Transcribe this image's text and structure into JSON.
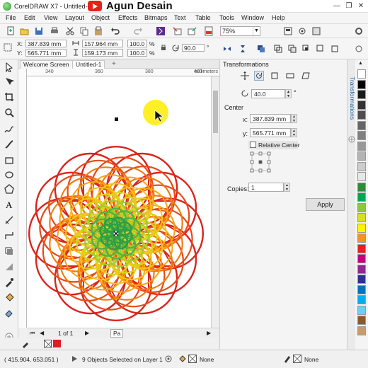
{
  "title_bar": {
    "title": "CorelDRAW X7 - Untitled-1",
    "brand": "Agun Desain"
  },
  "menu": [
    "File",
    "Edit",
    "View",
    "Layout",
    "Object",
    "Effects",
    "Bitmaps",
    "Text",
    "Table",
    "Tools",
    "Window",
    "Help"
  ],
  "toolbar": {
    "zoom": "75%"
  },
  "property_bar": {
    "x": "387.839 mm",
    "y": "565.771 mm",
    "w": "157.964 mm",
    "h": "159.173 mm",
    "sx": "100.0",
    "sy": "100.0",
    "pct": "%",
    "angle": "90.0",
    "deg": "°"
  },
  "tabs": [
    "Welcome Screen",
    "Untitled-1"
  ],
  "ruler": {
    "ticks": [
      "340",
      "360",
      "380",
      "400",
      "420"
    ],
    "unit": "millimeters"
  },
  "page_nav": {
    "page": "1 of 1",
    "tab": "Pa"
  },
  "docker": {
    "title": "Transformations",
    "rotation": "40.0",
    "deg": "°",
    "center_label": "Center",
    "x_label": "x:",
    "x": "387.839 mm",
    "y_label": "y:",
    "y": "565.771 mm",
    "unit": "mm",
    "relative_center": "Relative Center",
    "copies_label": "Copies:",
    "copies": "1",
    "apply": "Apply",
    "side_tab": "Transformations"
  },
  "status": {
    "coords": "( 415.904, 653.051 )",
    "selection": "9 Objects Selected on Layer 1",
    "fill_none": "None",
    "outline_none": "None"
  },
  "palette_colors": [
    "#ffffff",
    "#000000",
    "#1a1a1a",
    "#333333",
    "#4d4d4d",
    "#666666",
    "#808080",
    "#999999",
    "#b3b3b3",
    "#cccccc",
    "#e6e6e6",
    "#2e8b3a",
    "#00a651",
    "#8dc63f",
    "#d7df23",
    "#fff200",
    "#f7941d",
    "#ed1c24",
    "#c4007a",
    "#92278f",
    "#2e3192",
    "#0072bc",
    "#00aeef",
    "#6dcff6",
    "#8b5a2b",
    "#c69c6d"
  ]
}
